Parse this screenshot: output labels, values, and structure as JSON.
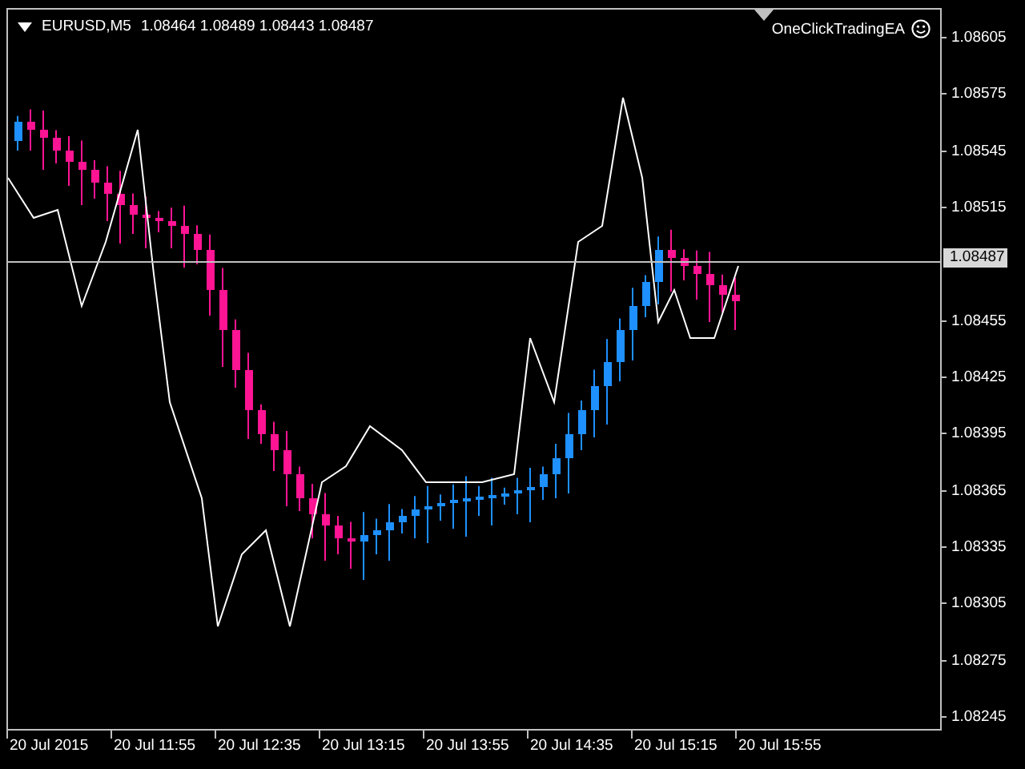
{
  "chart_header": {
    "symbol": "EURUSD,M5",
    "ohlc": "1.08464 1.08489 1.08443 1.08487"
  },
  "expert_advisor": {
    "name": "OneClickTradingEA"
  },
  "price_axis": {
    "ticks": [
      "1.08605",
      "1.08575",
      "1.08545",
      "1.08515",
      "1.08455",
      "1.08425",
      "1.08395",
      "1.08365",
      "1.08335",
      "1.08305",
      "1.08275",
      "1.08245"
    ],
    "current_price": "1.08487"
  },
  "time_axis": {
    "labels": [
      "20 Jul 2015",
      "20 Jul 11:55",
      "20 Jul 12:35",
      "20 Jul 13:15",
      "20 Jul 13:55",
      "20 Jul 14:35",
      "20 Jul 15:15",
      "20 Jul 15:55"
    ]
  }
}
